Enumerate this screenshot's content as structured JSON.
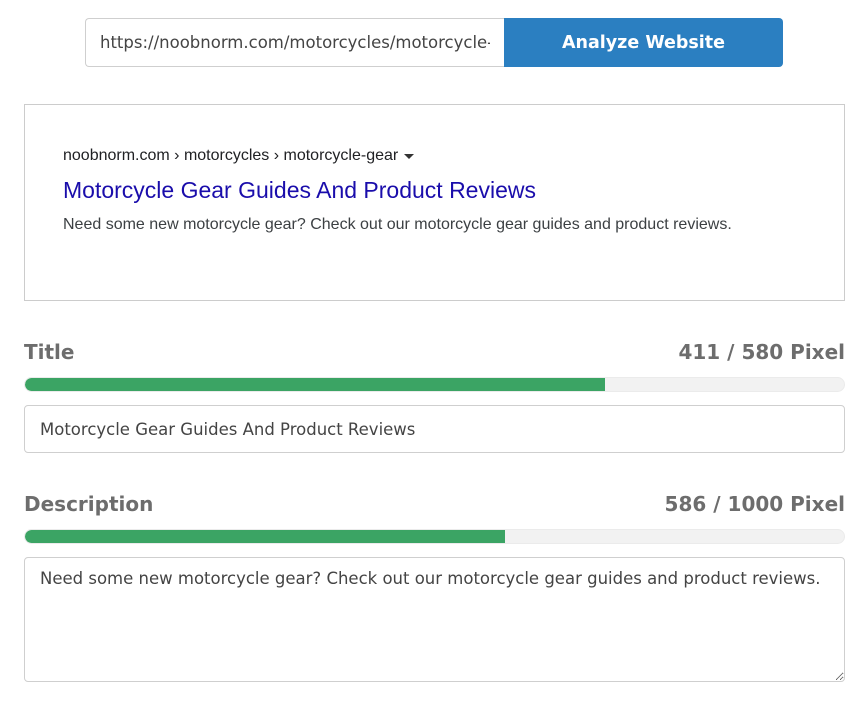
{
  "url_bar": {
    "value": "https://noobnorm.com/motorcycles/motorcycle-gear",
    "button_label": "Analyze Website"
  },
  "serp_preview": {
    "breadcrumb": "noobnorm.com › motorcycles › motorcycle-gear",
    "title": "Motorcycle Gear Guides And Product Reviews",
    "description": "Need some new motorcycle gear? Check out our motorcycle gear guides and product reviews."
  },
  "title_section": {
    "label": "Title",
    "count": "411 / 580 Pixel",
    "fill_fraction": 0.7086,
    "value": "Motorcycle Gear Guides And Product Reviews"
  },
  "description_section": {
    "label": "Description",
    "count": "586 / 1000 Pixel",
    "fill_fraction": 0.586,
    "value": "Need some new motorcycle gear? Check out our motorcycle gear guides and product reviews."
  },
  "colors": {
    "accent": "#2b7fc1",
    "progress": "#3ba464",
    "serp_link": "#1a0dab"
  },
  "icons": {
    "breadcrumb_dropdown": "caret-down-icon"
  }
}
